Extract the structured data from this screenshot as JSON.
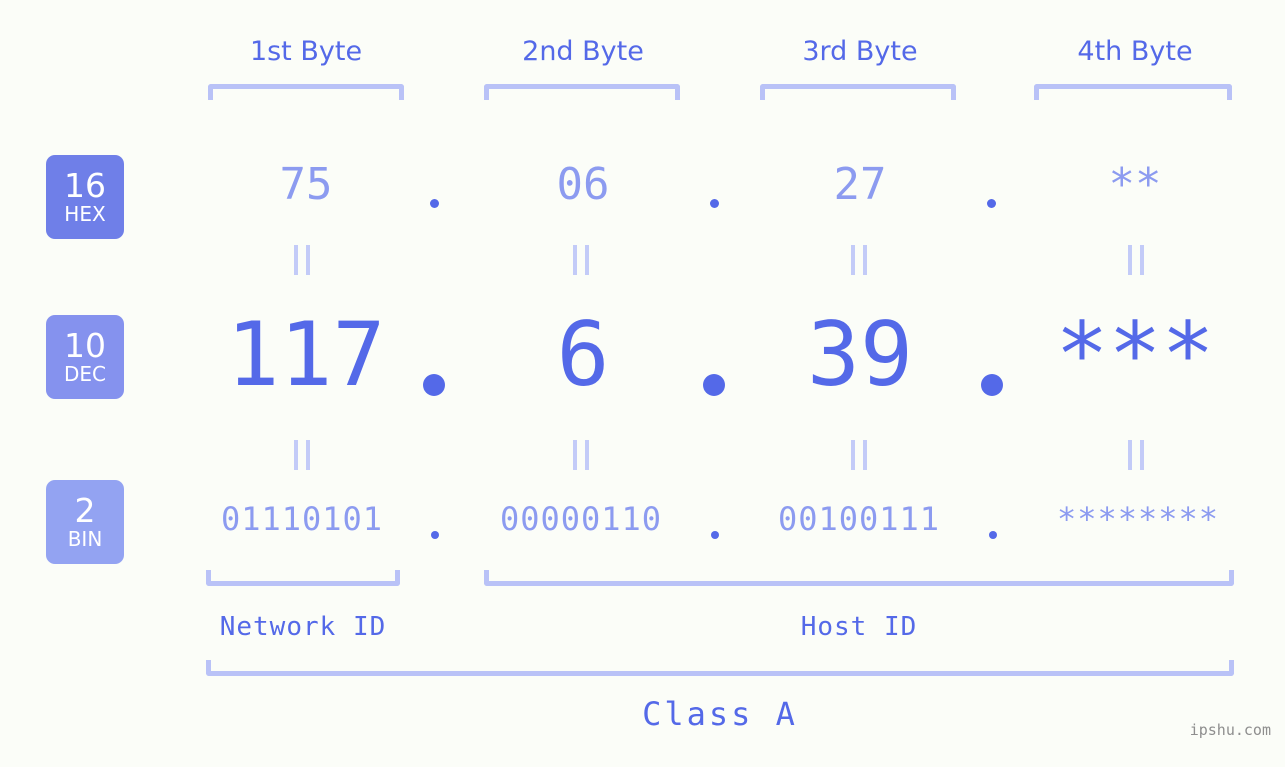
{
  "background_color": "#fbfdf8",
  "accent_color": "#5469e8",
  "accent_light_color": "#8c9bf0",
  "bracket_color": "#b9c2f7",
  "byte_headers": [
    {
      "label": "1st Byte"
    },
    {
      "label": "2nd Byte"
    },
    {
      "label": "3rd Byte"
    },
    {
      "label": "4th Byte"
    }
  ],
  "rows": [
    {
      "base_number": "16",
      "base_name": "HEX",
      "badge_color": "#6f7fe8",
      "values": [
        "75",
        "06",
        "27",
        "**"
      ]
    },
    {
      "base_number": "10",
      "base_name": "DEC",
      "badge_color": "#8592ee",
      "values": [
        "117",
        "6",
        "39",
        "***"
      ]
    },
    {
      "base_number": "2",
      "base_name": "BIN",
      "badge_color": "#93a3f2",
      "values": [
        "01110101",
        "00000110",
        "00100111",
        "********"
      ]
    }
  ],
  "separator": ".",
  "equivalence_mark": "||",
  "sections": [
    {
      "label": "Network ID"
    },
    {
      "label": "Host ID"
    }
  ],
  "class": {
    "label": "Class A"
  },
  "watermark": {
    "text": "ipshu.com"
  }
}
